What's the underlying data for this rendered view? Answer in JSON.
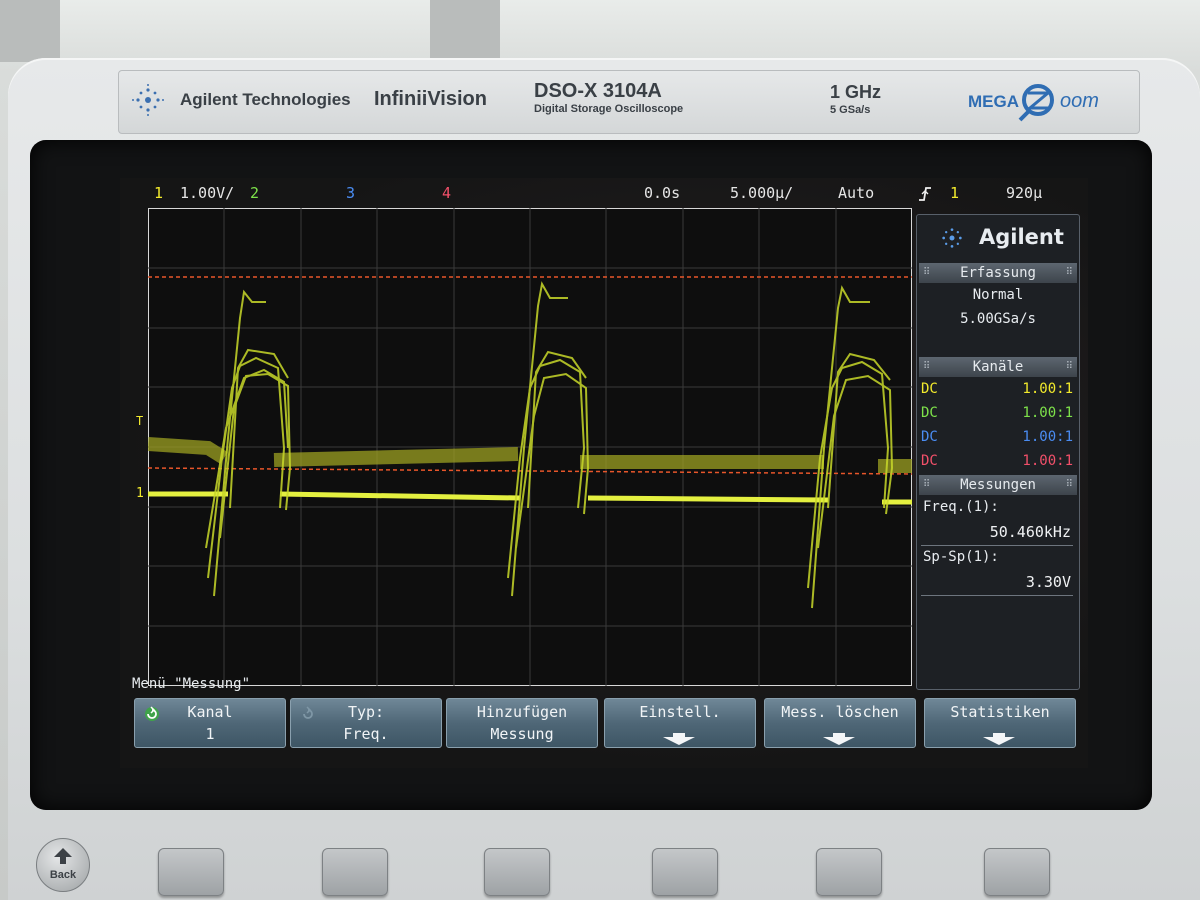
{
  "header": {
    "brand": "Agilent Technologies",
    "series": "InfiniiVision",
    "model": "DSO-X 3104A",
    "model_subtitle": "Digital Storage Oscilloscope",
    "bandwidth": "1 GHz",
    "sample_rate": "5 GSa/s",
    "logo_mega": "MEGA",
    "logo_zoom": "oom"
  },
  "status_line": {
    "ch1_num": "1",
    "ch1_scale": "1.00V/",
    "ch2_num": "2",
    "ch3_num": "3",
    "ch4_num": "4",
    "time_offset": "0.0s",
    "timebase": "5.000µ/",
    "trigger_mode": "Auto",
    "trigger_slope_icon": "rising-edge-trigger-icon",
    "trigger_source": "1",
    "trigger_level": "920µ"
  },
  "panel": {
    "brand": "Agilent",
    "acquisition": {
      "header": "Erfassung",
      "mode": "Normal",
      "rate": "5.00GSa/s"
    },
    "channels": {
      "header": "Kanäle",
      "rows": [
        {
          "coupling": "DC",
          "ratio": "1.00:1",
          "color": "#f2ea2c"
        },
        {
          "coupling": "DC",
          "ratio": "1.00:1",
          "color": "#7ee24a"
        },
        {
          "coupling": "DC",
          "ratio": "1.00:1",
          "color": "#4a8cf2"
        },
        {
          "coupling": "DC",
          "ratio": "1.00:1",
          "color": "#f2506a"
        }
      ]
    },
    "measurements": {
      "header": "Messungen",
      "items": [
        {
          "label": "Freq.(1):",
          "value": "50.460kHz"
        },
        {
          "label": "Sp-Sp(1):",
          "value": "3.30V"
        }
      ]
    }
  },
  "screen_markers": {
    "ch1_ground_label": "1",
    "trigger_marker_label": "T"
  },
  "menu": {
    "title": "Menü \"Messung\"",
    "softkeys": [
      {
        "line1": "Kanal",
        "line2": "1",
        "icon": "rotate-select-icon"
      },
      {
        "line1": "Typ:",
        "line2": "Freq.",
        "icon": "rotate-select-icon"
      },
      {
        "line1": "Hinzufügen",
        "line2": "Messung"
      },
      {
        "line1": "Einstell.",
        "line2": "",
        "icon": "submenu-arrow-icon"
      },
      {
        "line1": "Mess. löschen",
        "line2": "",
        "icon": "submenu-arrow-icon"
      },
      {
        "line1": "Statistiken",
        "line2": "",
        "icon": "submenu-arrow-icon"
      }
    ]
  },
  "back_button": {
    "label": "Back"
  },
  "colors": {
    "ch1": "#f2ea2c",
    "ch2": "#7ee24a",
    "ch3": "#4a8cf2",
    "ch4": "#f2506a",
    "trace": "#c8d82a",
    "cursor": "#e8562a"
  }
}
